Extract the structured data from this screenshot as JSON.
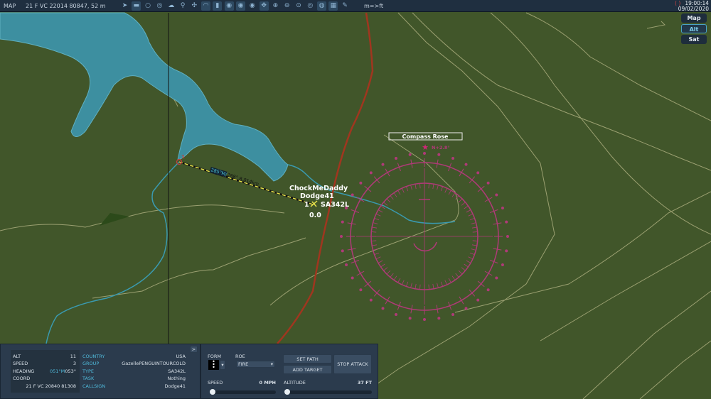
{
  "topbar": {
    "title": "MAP",
    "coords": "21 F VC 22014 80847, 52 m",
    "unit_toggle": "m=>ft",
    "time": "19:00:14",
    "date": "09/02/2020",
    "tools": [
      "send-icon",
      "ruler-icon",
      "circle-icon",
      "layers-icon",
      "cloud-icon",
      "network-icon",
      "target-icon",
      "wifi-icon",
      "tower-icon",
      "unit-a-icon",
      "unit-b-icon",
      "unit-c-icon",
      "move-icon",
      "zoom-in-icon",
      "zoom-out-icon",
      "zoom-reset-icon",
      "radar-icon",
      "globe-icon",
      "grid-icon",
      "pen-icon"
    ]
  },
  "layers": {
    "map": "Map",
    "alt": "Alt",
    "sat": "Sat",
    "selected": "Alt"
  },
  "map": {
    "unit_name": "ChockMeDaddy",
    "unit_callsign": "Dodge41",
    "unit_type": "SA342L",
    "unit_index": "1",
    "unit_speed": "0.0",
    "waypoint_index": "1",
    "leg_label_mag": "285°M/",
    "leg_label_rest": "288° 8.814km",
    "compass_title": "Compass Rose",
    "compass_north": "N+2.8°"
  },
  "info": {
    "expand": ">",
    "alt_label": "ALT",
    "alt": "11",
    "speed_label": "SPEED",
    "speed": "3",
    "heading_label": "HEADING",
    "heading_mag": "051°M",
    "heading_true": "053°",
    "coord_label": "COORD",
    "coord": "21 F VC 20840 81308",
    "country_label": "COUNTRY",
    "country": "USA",
    "group_label": "GROUP",
    "group": "GazellePENGUINTOURCOLD",
    "type_label": "TYPE",
    "type": "SA342L",
    "task_label": "TASK",
    "task": "Nothing",
    "callsign_label": "CALLSIGN",
    "callsign": "Dodge41"
  },
  "control": {
    "form_label": "FORM",
    "roe_label": "ROE",
    "roe": "FIRE",
    "set_path": "SET PATH",
    "add_target": "ADD TARGET",
    "stop_attack": "STOP ATTACK",
    "speed_label": "SPEED",
    "speed": "0 MPH",
    "altitude_label": "ALTITUDE",
    "altitude": "37 FT",
    "speed_fraction": 0,
    "altitude_fraction": 0
  },
  "colors": {
    "terrain": "#41562a",
    "water": "#3d8fa0",
    "road": "#a0361f",
    "compass": "#b03a78",
    "panel": "#2b3b4d",
    "accent": "#4fb8d9"
  }
}
